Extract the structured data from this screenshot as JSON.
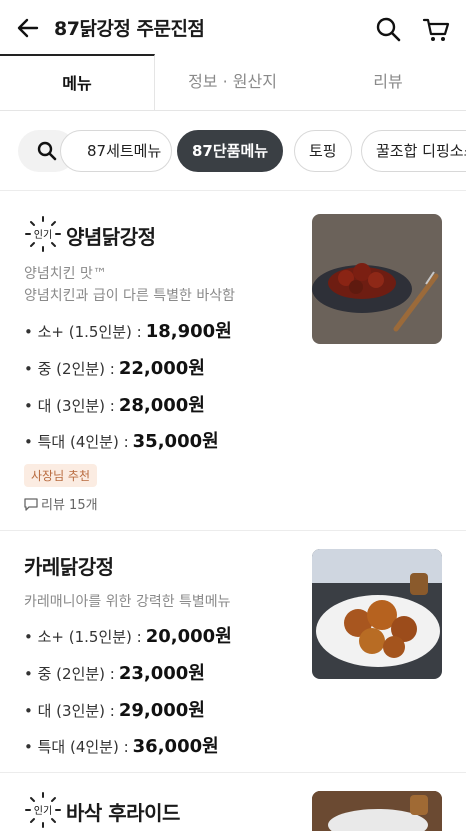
{
  "header": {
    "title": "87닭강정 주문진점",
    "icons": [
      "back-arrow-icon",
      "search-icon",
      "cart-icon"
    ]
  },
  "tabs": [
    {
      "label": "메뉴",
      "active": true
    },
    {
      "label": "정보 · 원산지",
      "active": false
    },
    {
      "label": "리뷰",
      "active": false
    }
  ],
  "chips": [
    {
      "label": "87세트메뉴",
      "active": false
    },
    {
      "label": "87단품메뉴",
      "active": true
    },
    {
      "label": "토핑",
      "active": false
    },
    {
      "label": "꿀조합 디핑소스",
      "active": false
    }
  ],
  "menu": [
    {
      "badge": "인기",
      "name": "양념닭강정",
      "desc1": "양념치킨 맛™",
      "desc2": "양념치킨과 급이 다른 특별한 바삭함",
      "prices": [
        {
          "label": "• 소+ (1.5인분) :",
          "price": "18,900원"
        },
        {
          "label": "• 중 (2인분) :",
          "price": "22,000원"
        },
        {
          "label": "• 대 (3인분) :",
          "price": "28,000원"
        },
        {
          "label": "• 특대 (4인분) :",
          "price": "35,000원"
        }
      ],
      "tag": "사장님 추천",
      "review": "리뷰 15개"
    },
    {
      "name": "카레닭강정",
      "desc1": "카레매니아를 위한 강력한 특별메뉴",
      "prices": [
        {
          "label": "• 소+ (1.5인분) :",
          "price": "20,000원"
        },
        {
          "label": "• 중 (2인분) :",
          "price": "23,000원"
        },
        {
          "label": "• 대 (3인분) :",
          "price": "29,000원"
        },
        {
          "label": "• 특대 (4인분) :",
          "price": "36,000원"
        }
      ]
    },
    {
      "badge": "인기",
      "name": "바삭 후라이드"
    }
  ],
  "colors": {
    "accent": "#3a3f44",
    "tag_bg": "#fbece2",
    "tag_text": "#b86a3e"
  }
}
